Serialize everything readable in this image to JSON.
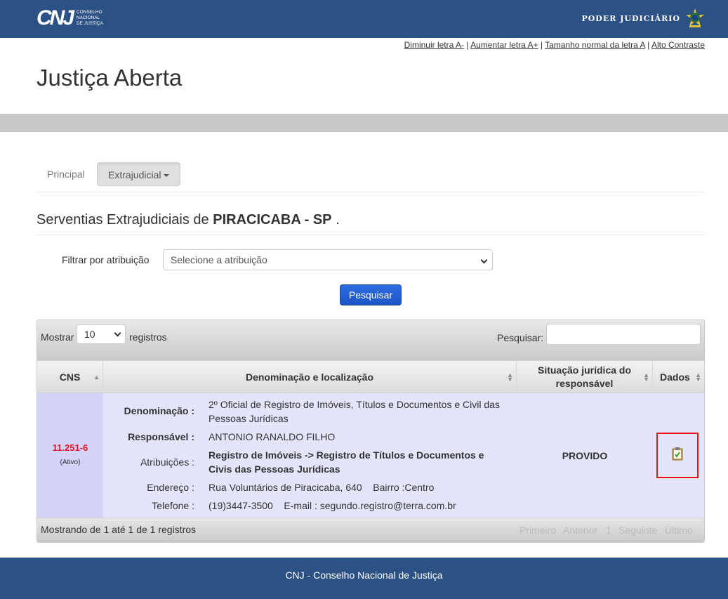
{
  "header": {
    "logo_mark": "CNJ",
    "logo_sub": [
      "CONSELHO",
      "NACIONAL",
      "DE JUSTIÇA"
    ],
    "poder": "PODER JUDICIÁRIO"
  },
  "accessibility": {
    "decrease": "Diminuir letra A-",
    "increase": "Aumentar letra A+",
    "normal": "Tamanho normal da letra A",
    "contrast": "Alto Contraste"
  },
  "site_title": "Justiça Aberta",
  "tabs": {
    "principal": "Principal",
    "extrajudicial": "Extrajudicial"
  },
  "heading": {
    "prefix": "Serventias Extrajudiciais de ",
    "city": "PIRACICABA - SP",
    "suffix": " ."
  },
  "filter": {
    "label": "Filtrar por atribuição",
    "selected": "Selecione a atribuição",
    "button": "Pesquisar"
  },
  "table": {
    "show_label": "Mostrar",
    "page_length": "10",
    "records_label": "registros",
    "search_label": "Pesquisar:",
    "columns": {
      "cns": "CNS",
      "denominacao": "Denominação e localização",
      "situacao": "Situação jurídica do responsável",
      "dados": "Dados"
    },
    "row": {
      "cns": "11.251-6",
      "cns_status": "(Ativo)",
      "labels": {
        "denominacao": "Denominação :",
        "responsavel": "Responsável :",
        "atribuicoes": "Atribuições :",
        "endereco": "Endereço :",
        "telefone": "Telefone :"
      },
      "denominacao": "2º Oficial de Registro de Imóveis, Títulos e Documentos e Civil das Pessoas Jurídicas",
      "responsavel": "ANTONIO RANALDO FILHO",
      "atribuicoes": "Registro de Imóveis -> Registro de Títulos e Documentos e Civis das Pessoas Jurídicas",
      "endereco": "Rua Voluntários de Piracicaba, 640    Bairro :Centro",
      "telefone": "(19)3447-3500    E-mail : segundo.registro@terra.com.br",
      "situacao": "PROVIDO",
      "dados_icon": "clipboard-check-icon"
    },
    "info": "Mostrando de 1 até 1 de 1 registros",
    "pagination": {
      "first": "Primeiro",
      "prev": "Anterior",
      "page": "1",
      "next": "Seguinte",
      "last": "Último"
    }
  },
  "footer": "CNJ - Conselho Nacional de Justiça",
  "colors": {
    "brand": "#2c5285",
    "cns_red": "#e8101e",
    "row_bg": "#e4e4fc",
    "highlight_box": "#e11111"
  }
}
